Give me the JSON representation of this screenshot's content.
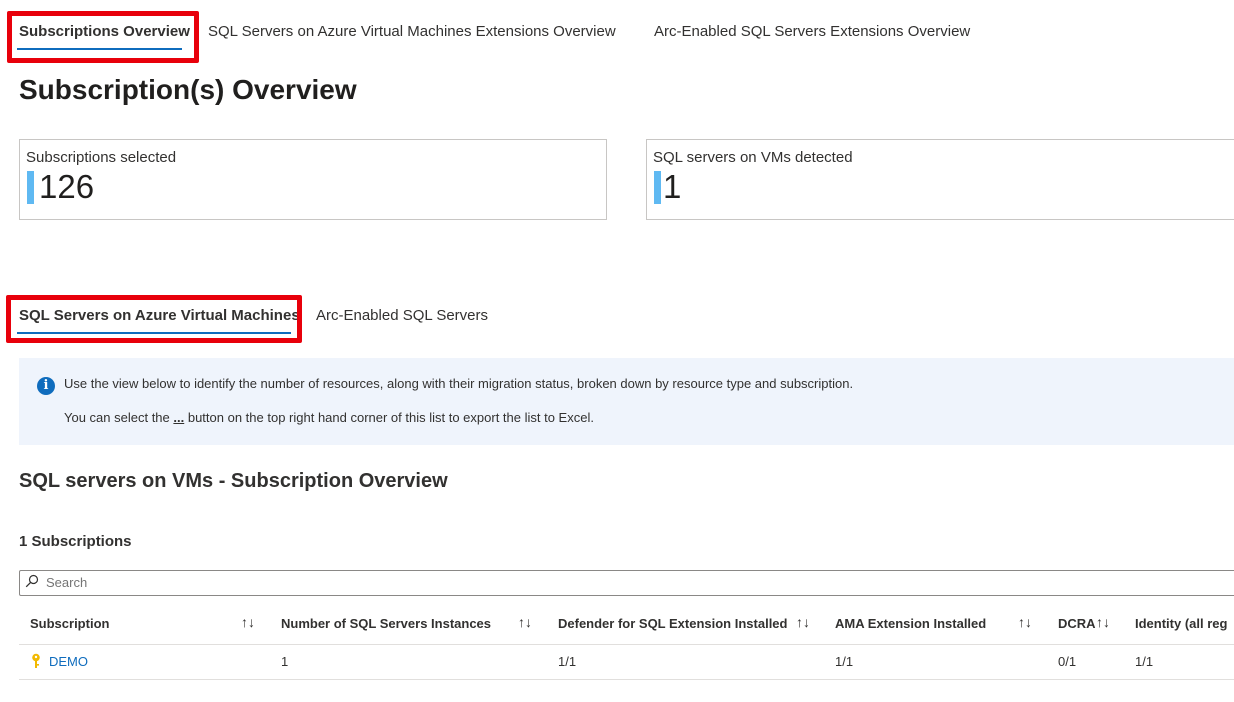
{
  "top_tabs": [
    {
      "label": "Subscriptions Overview",
      "active": true
    },
    {
      "label": "SQL Servers on Azure Virtual Machines Extensions Overview",
      "active": false
    },
    {
      "label": "Arc-Enabled SQL Servers Extensions Overview",
      "active": false
    }
  ],
  "page_title": "Subscription(s) Overview",
  "cards": [
    {
      "label": "Subscriptions selected",
      "value": "126"
    },
    {
      "label": "SQL servers on VMs detected",
      "value": "1"
    }
  ],
  "sub_tabs": [
    {
      "label": "SQL Servers on Azure Virtual Machines",
      "active": true
    },
    {
      "label": "Arc-Enabled SQL Servers",
      "active": false
    }
  ],
  "info": {
    "icon": "info-icon",
    "line1": "Use the view below to identify the number of resources, along with their migration status, broken down by resource type and subscription.",
    "line2_prefix": "You can select the ",
    "line2_ellipsis": "...",
    "line2_suffix": " button on the top right hand corner of this list to export the list to Excel."
  },
  "section_title": "SQL servers on VMs - Subscription Overview",
  "count_label": "1 Subscriptions",
  "search": {
    "placeholder": "Search",
    "icon": "search-icon"
  },
  "table": {
    "columns": [
      "Subscription",
      "Number of SQL Servers Instances",
      "Defender for SQL Extension Installed",
      "AMA Extension Installed",
      "DCRA",
      "Identity (all reg"
    ],
    "sort_glyph": "↑↓",
    "rows": [
      {
        "subscription": "DEMO",
        "instances": "1",
        "defender": "1/1",
        "ama": "1/1",
        "dcra": "0/1",
        "identity": "1/1"
      }
    ]
  },
  "colors": {
    "accent": "#0f6cbd",
    "highlight": "#e8000b",
    "card_bar": "#5fb9f2",
    "info_bg": "#eff4fc",
    "key_icon": "#f2b900"
  }
}
